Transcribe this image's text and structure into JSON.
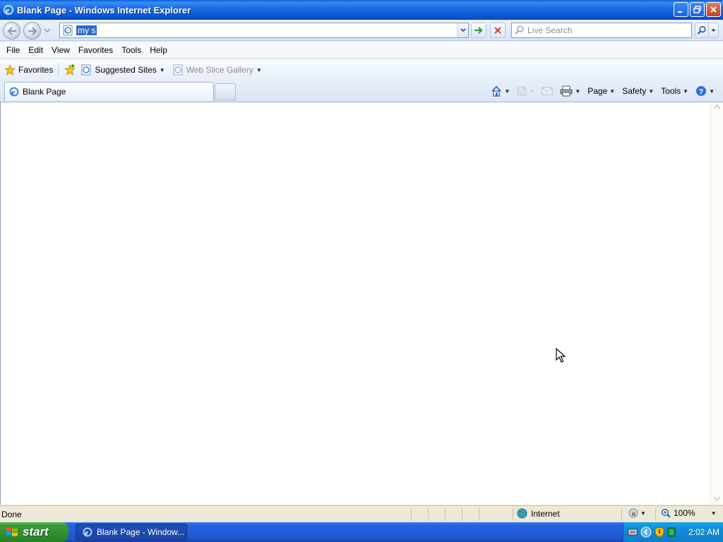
{
  "window": {
    "title": "Blank Page - Windows Internet Explorer"
  },
  "address": {
    "value": "my s"
  },
  "search": {
    "placeholder": "Live Search"
  },
  "menu": {
    "items": [
      "File",
      "Edit",
      "View",
      "Favorites",
      "Tools",
      "Help"
    ]
  },
  "favorites_bar": {
    "favorites_label": "Favorites",
    "suggested_sites": "Suggested Sites",
    "web_slice_gallery": "Web Slice Gallery"
  },
  "tabs": [
    {
      "label": "Blank Page",
      "active": true
    }
  ],
  "command_bar": {
    "page": "Page",
    "safety": "Safety",
    "tools": "Tools"
  },
  "status": {
    "text": "Done",
    "zone": "Internet",
    "zoom": "100%"
  },
  "taskbar": {
    "start": "start",
    "task": "Blank Page - Window...",
    "clock": "2:02 AM"
  },
  "colors": {
    "titlebar": "#0a55d0",
    "taskbar": "#245edb",
    "start": "#2f8f2f",
    "selection": "#316ac5"
  }
}
